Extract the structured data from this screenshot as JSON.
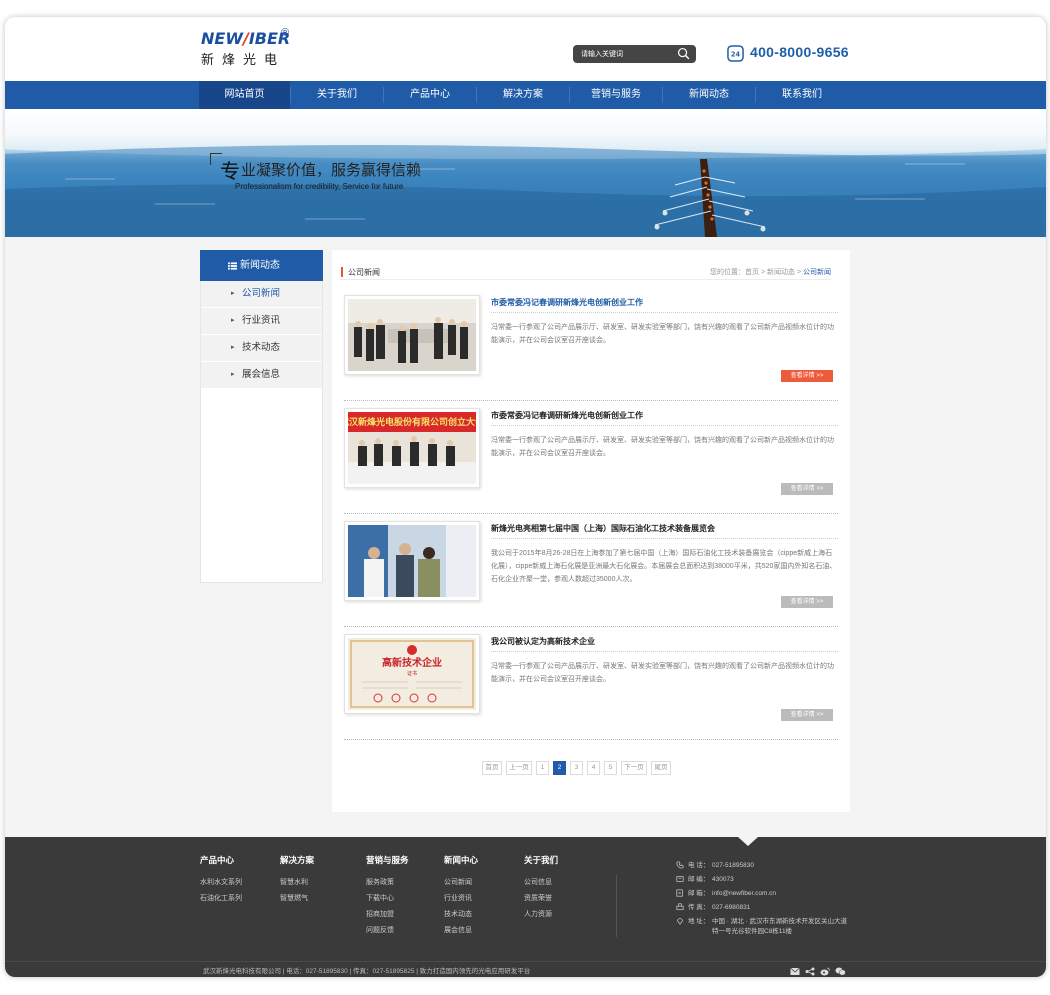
{
  "brand": {
    "logo_en_a": "NEW",
    "logo_en_slash": "/",
    "logo_en_b": "IBER",
    "logo_reg": "®",
    "logo_cn": "新烽光电"
  },
  "search": {
    "placeholder": "请输入关键词"
  },
  "hotline": {
    "number": "400-8000-9656"
  },
  "nav": [
    {
      "label": "网站首页"
    },
    {
      "label": "关于我们"
    },
    {
      "label": "产品中心"
    },
    {
      "label": "解决方案"
    },
    {
      "label": "营销与服务"
    },
    {
      "label": "新闻动态"
    },
    {
      "label": "联系我们"
    }
  ],
  "banner": {
    "slogan_char": "专",
    "slogan_cn": "业凝聚价值，服务赢得信赖",
    "slogan_en": "Professionalism for credibility, Service for future"
  },
  "sidebar": {
    "title": "新闻动态",
    "items": [
      {
        "label": "公司新闻"
      },
      {
        "label": "行业资讯"
      },
      {
        "label": "技术动态"
      },
      {
        "label": "展会信息"
      }
    ]
  },
  "main": {
    "section_title": "公司新闻",
    "breadcrumb": {
      "prefix": "您的位置：",
      "home": "首页",
      "sep": ">",
      "level1": "新闻动态",
      "current": "公司新闻"
    },
    "news": [
      {
        "title": "市委常委冯记春调研新烽光电创新创业工作",
        "summary": "冯常委一行参观了公司产品展示厅、研发室、研发实验室等部门，饶有兴趣的观看了公司新产品视频水位计的功能演示，并在公司会议室召开座谈会。",
        "more": "查看详情 >>"
      },
      {
        "title": "市委常委冯记春调研新烽光电创新创业工作",
        "summary": "冯常委一行参观了公司产品展示厅、研发室、研发实验室等部门，饶有兴趣的观看了公司新产品视频水位计的功能演示，并在公司会议室召开座谈会。",
        "more": "查看详情 >>",
        "banner_text": "武汉新烽光电股份有限公司创立大会"
      },
      {
        "title": "新烽光电亮相第七届中国（上海）国际石油化工技术装备展览会",
        "summary": "我公司于2015年8月26-28日在上海参加了第七届中国（上海）国际石油化工技术装备展览会（cippe新威上海石化展），cippe新威上海石化展是亚洲最大石化展会。本届展会总面积达到38000平米，共520家国内外知名石油、石化企业齐聚一堂，参观人数超过35000人次。",
        "more": "查看详情 >>"
      },
      {
        "title": "我公司被认定为高新技术企业",
        "summary": "冯常委一行参观了公司产品展示厅、研发室、研发实验室等部门，饶有兴趣的观看了公司新产品视频水位计的功能演示，并在公司会议室召开座谈会。",
        "more": "查看详情 >>",
        "cert_title": "高新技术企业",
        "cert_sub": "证书"
      }
    ],
    "pager": [
      "首页",
      "上一页",
      "1",
      "2",
      "3",
      "4",
      "5",
      "下一页",
      "尾页"
    ],
    "current_page": "2"
  },
  "footer": {
    "columns": [
      {
        "title": "产品中心",
        "links": [
          "水利水文系列",
          "石油化工系列"
        ]
      },
      {
        "title": "解决方案",
        "links": [
          "智慧水利",
          "智慧燃气"
        ]
      },
      {
        "title": "营销与服务",
        "links": [
          "服务政策",
          "下载中心",
          "招商加盟",
          "问题反馈"
        ]
      },
      {
        "title": "新闻中心",
        "links": [
          "公司新闻",
          "行业资讯",
          "技术动态",
          "展会信息"
        ]
      },
      {
        "title": "关于我们",
        "links": [
          "公司信息",
          "资质荣誉",
          "人力资源"
        ]
      }
    ],
    "contact": [
      {
        "icon": "phone-icon",
        "label": "电 话：",
        "value": "027-51895830"
      },
      {
        "icon": "mailbox-icon",
        "label": "邮 编：",
        "value": "430073"
      },
      {
        "icon": "email-icon",
        "label": "邮 箱：",
        "value": "info@newfiber.com.cn"
      },
      {
        "icon": "fax-icon",
        "label": "传 真：",
        "value": "027-6980831"
      },
      {
        "icon": "location-icon",
        "label": "地 址：",
        "value": "中国 · 湖北 · 武汉市东湖新技术开发区关山大道",
        "value2": "特一号光谷软件园C8栋11楼"
      }
    ],
    "bottom": "武汉新烽光电科技有限公司  |  电话：027-51895830  |  传真：027-51895825  |  致力打造国内领先的光电应用研发平台"
  },
  "colors": {
    "primary": "#1f5ba6",
    "nav_active": "#17468a",
    "accent": "#ef5a3a",
    "footer": "#3a3a3a"
  }
}
